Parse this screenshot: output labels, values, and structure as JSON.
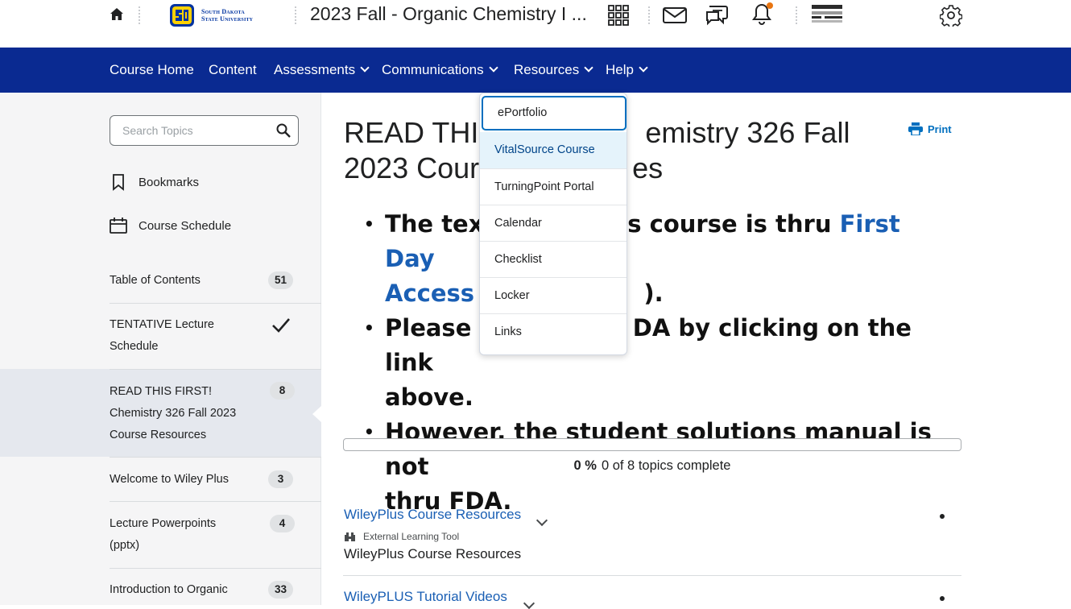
{
  "topbar": {
    "org_line1": "South Dakota",
    "org_line2": "State University",
    "course_title": "2023 Fall - Organic Chemistry I ...",
    "icons": [
      "home-icon",
      "app-grid-icon",
      "mail-icon",
      "chat-icon",
      "bell-icon",
      "avatar",
      "gear-icon"
    ],
    "notification_dot_color": "#e87511"
  },
  "nav": {
    "items": [
      {
        "label": "Course Home"
      },
      {
        "label": "Content"
      },
      {
        "label": "Assessments",
        "dropdown": true
      },
      {
        "label": "Communications",
        "dropdown": true
      },
      {
        "label": "Resources",
        "dropdown": true
      },
      {
        "label": "Help",
        "dropdown": true
      }
    ],
    "background": "#0a2a91"
  },
  "sidebar": {
    "search_placeholder": "Search Topics",
    "bookmarks": "Bookmarks",
    "course_schedule": "Course Schedule",
    "toc": [
      {
        "label": "Table of Contents",
        "badge": "51"
      },
      {
        "label": "TENTATIVE Lecture Schedule",
        "complete": true
      },
      {
        "label": "READ THIS FIRST! Chemistry 326 Fall 2023 Course Resources",
        "badge": "8",
        "active": true
      },
      {
        "label": "Welcome to Wiley Plus",
        "badge": "3"
      },
      {
        "label": "Lecture Powerpoints (pptx)",
        "badge": "4"
      },
      {
        "label": "Introduction to Organic",
        "badge": "33"
      }
    ]
  },
  "main": {
    "title": "READ THIS FIRST! Chemistry 326 Fall 2023 Course Resources",
    "title_visible_left": "READ THIS",
    "title_visible_right": "emistry 326 Fall",
    "title_line2_left": "2023 Cour",
    "title_line2_right": "es",
    "print_label": "Print",
    "bullet1_left": "The text",
    "bullet1_right": "s course is thru ",
    "bullet1_link": "First Day",
    "bullet1_link2": "Access (",
    "bullet1_end": ").",
    "bullet2_left": "Please r",
    "bullet2_right": "DA by clicking on the link",
    "bullet2_line2": "above.",
    "bullet3": "However, the student solutions manual is not",
    "bullet3_line2": "thru FDA.",
    "progress_percent": "0 %",
    "progress_text": "0 of 8 topics complete",
    "progress_value": 0,
    "items": [
      {
        "title": "WileyPlus Course Resources",
        "type": "External Learning Tool",
        "subtitle": "WileyPlus Course Resources"
      },
      {
        "title": "WileyPLUS Tutorial Videos"
      }
    ]
  },
  "resources_menu": {
    "items": [
      {
        "label": "ePortfolio",
        "state": "focused"
      },
      {
        "label": "VitalSource Course",
        "state": "hover"
      },
      {
        "label": "TurningPoint Portal"
      },
      {
        "label": "Calendar"
      },
      {
        "label": "Checklist"
      },
      {
        "label": "Locker"
      },
      {
        "label": "Links"
      }
    ]
  }
}
